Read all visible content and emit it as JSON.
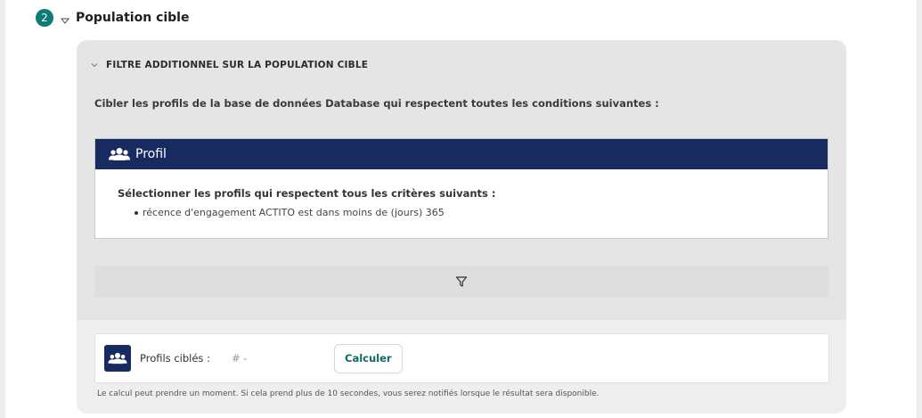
{
  "step": {
    "number": "2",
    "title": "Population cible"
  },
  "filter": {
    "title": "FILTRE ADDITIONNEL SUR LA POPULATION CIBLE",
    "intro": "Cibler les profils de la base de données Database qui respectent toutes les conditions suivantes :"
  },
  "profil": {
    "title": "Profil",
    "criteria_title": "Sélectionner les profils qui respectent tous les critères suivants :",
    "criteria": [
      "récence d'engagement ACTITO est dans moins de (jours) 365"
    ]
  },
  "target": {
    "label": "Profils ciblés :",
    "value": "# -",
    "calculate_label": "Calculer"
  },
  "note": "Le calcul peut prendre un moment. Si cela prend plus de 10 secondes, vous serez notifiés lorsque le résultat sera disponible.",
  "colors": {
    "accent": "#0e7c74",
    "header": "#172b61"
  },
  "icons": {
    "step_toggle": "chevron-down-icon",
    "filter_toggle": "chevron-down-icon",
    "profil": "users-icon",
    "filter": "funnel-icon"
  }
}
